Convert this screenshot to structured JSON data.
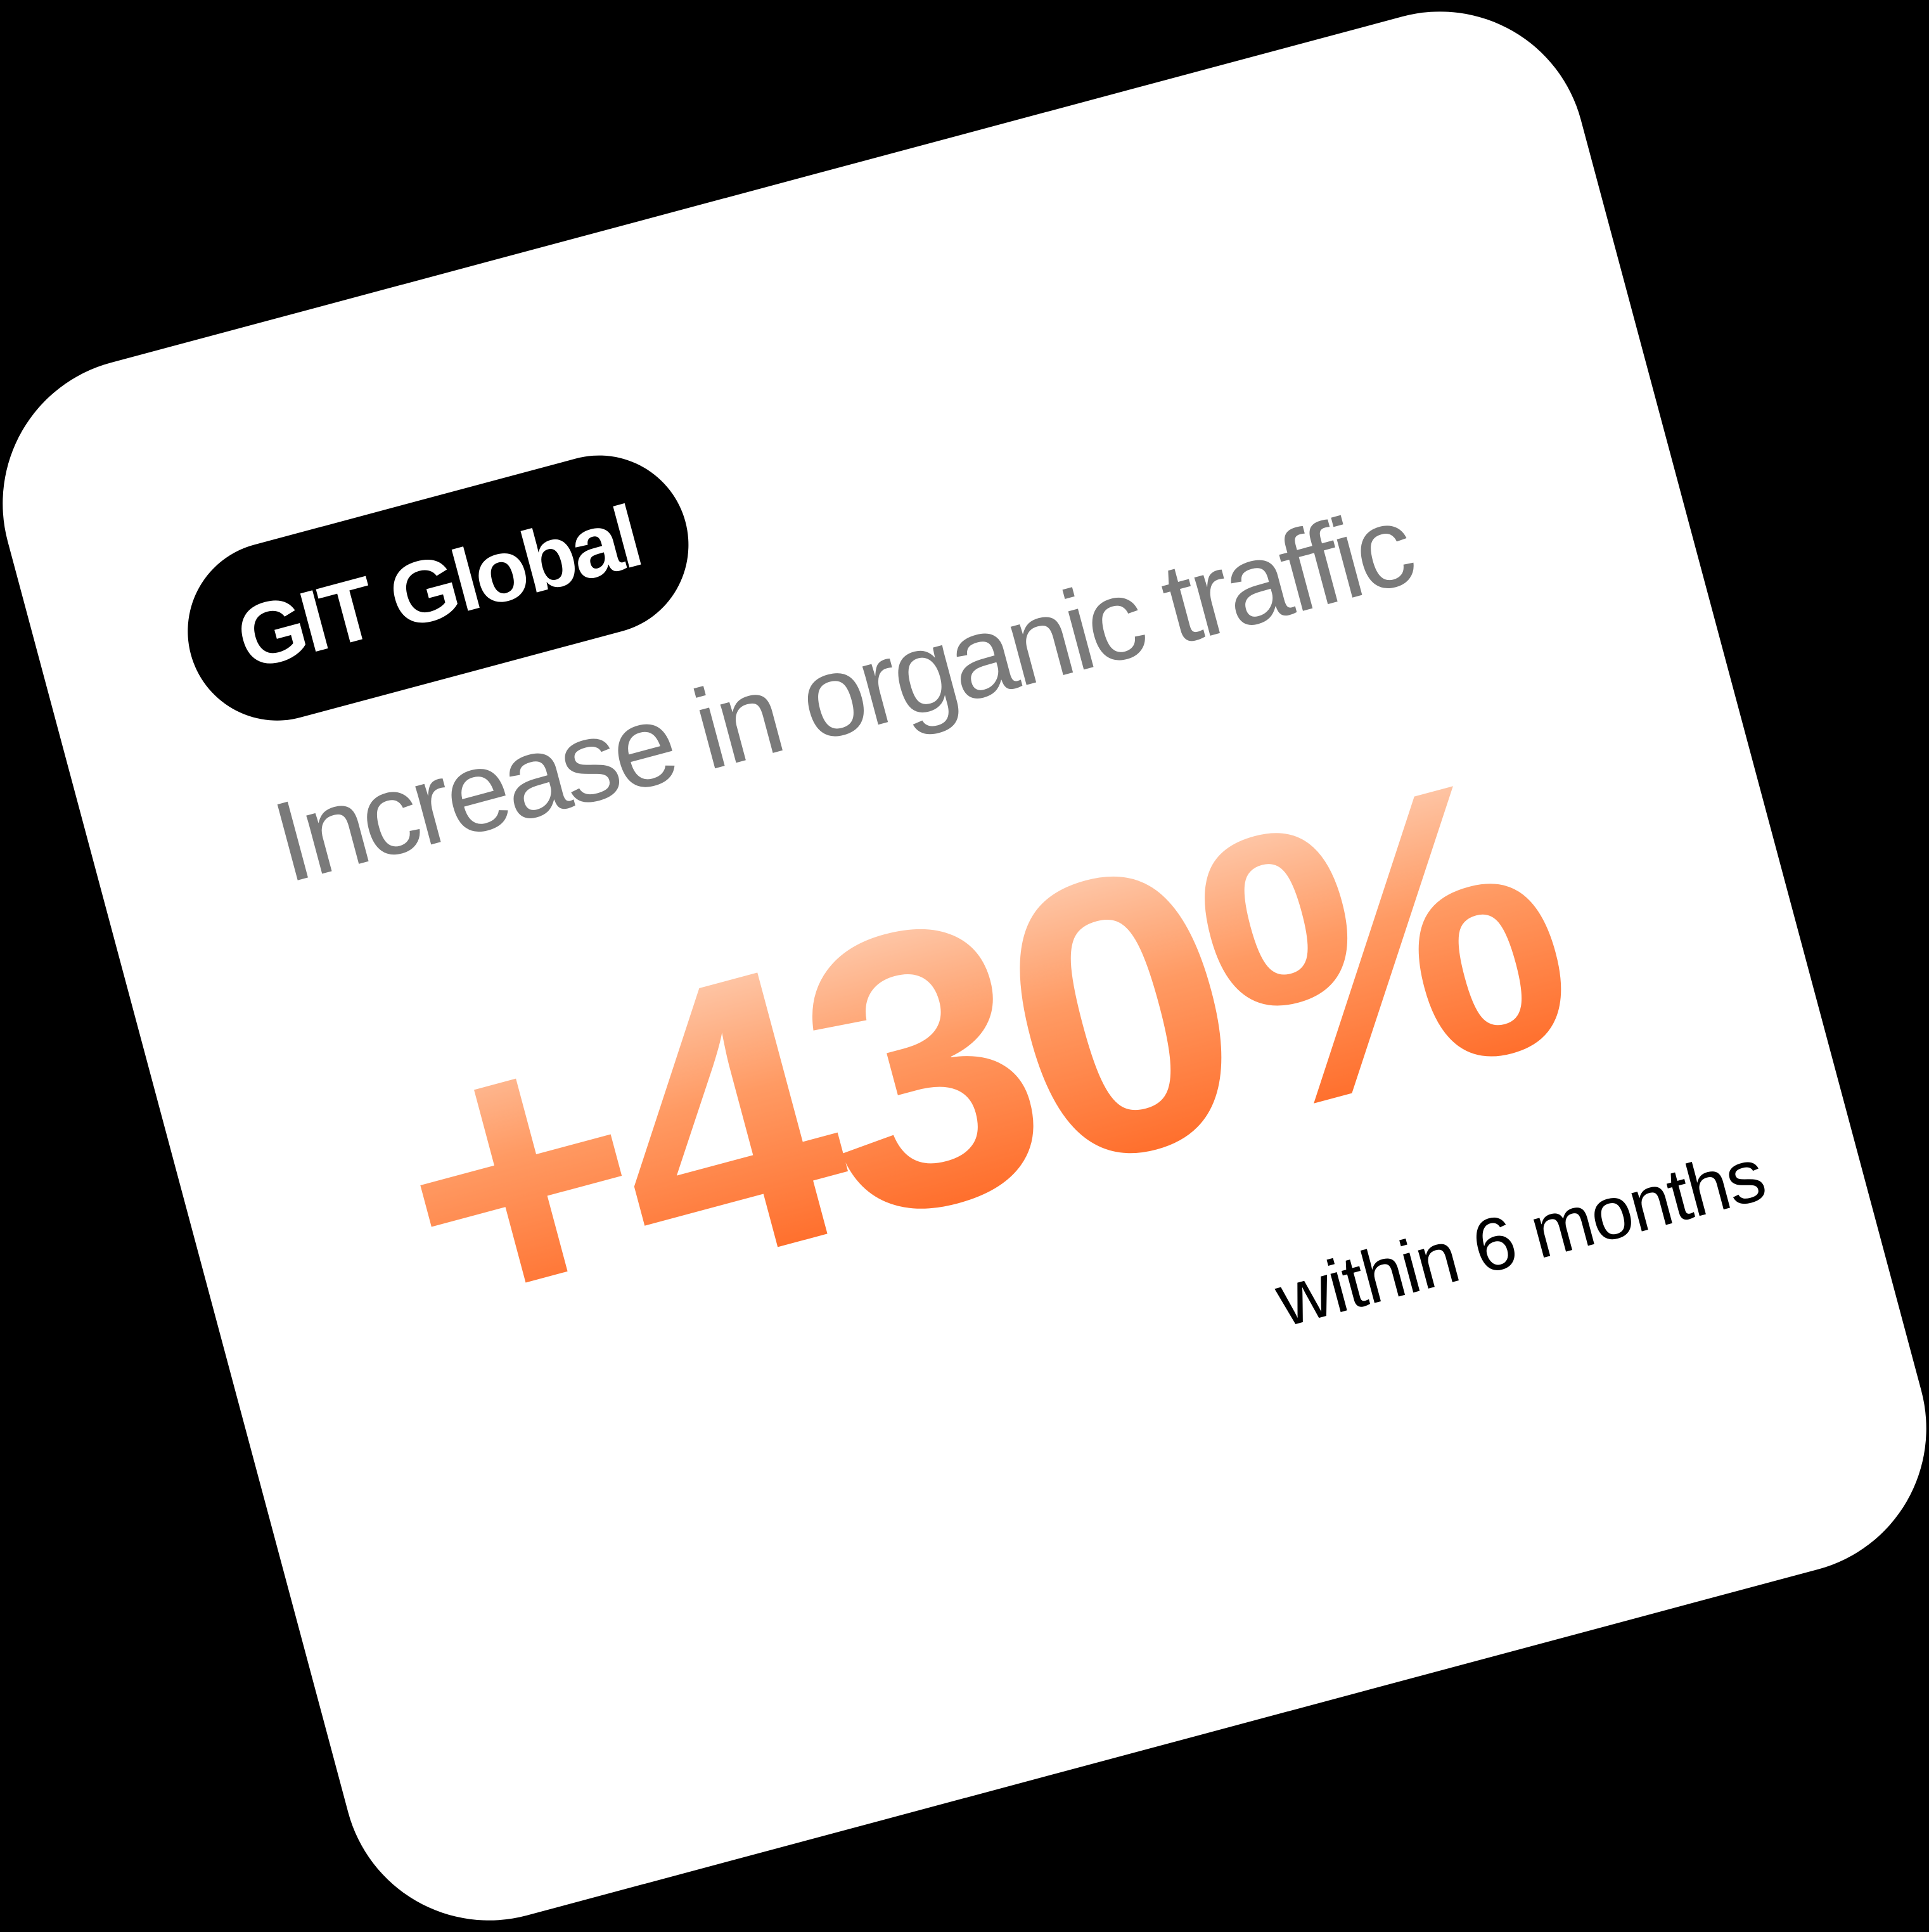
{
  "card": {
    "badge": "GIT Global",
    "subtitle": "Increase in organic traffic",
    "stat_value": "+430%",
    "stat_period": "within 6 months"
  },
  "colors": {
    "background": "#000000",
    "card": "#ffffff",
    "badge_background": "#000000",
    "badge_text": "#ffffff",
    "subtitle_text": "#7a7a7a",
    "stat_gradient_light": "#fde3d3",
    "stat_gradient_mid": "#ff9a63",
    "stat_gradient_dark": "#ff5a12",
    "period_text": "#000000"
  }
}
